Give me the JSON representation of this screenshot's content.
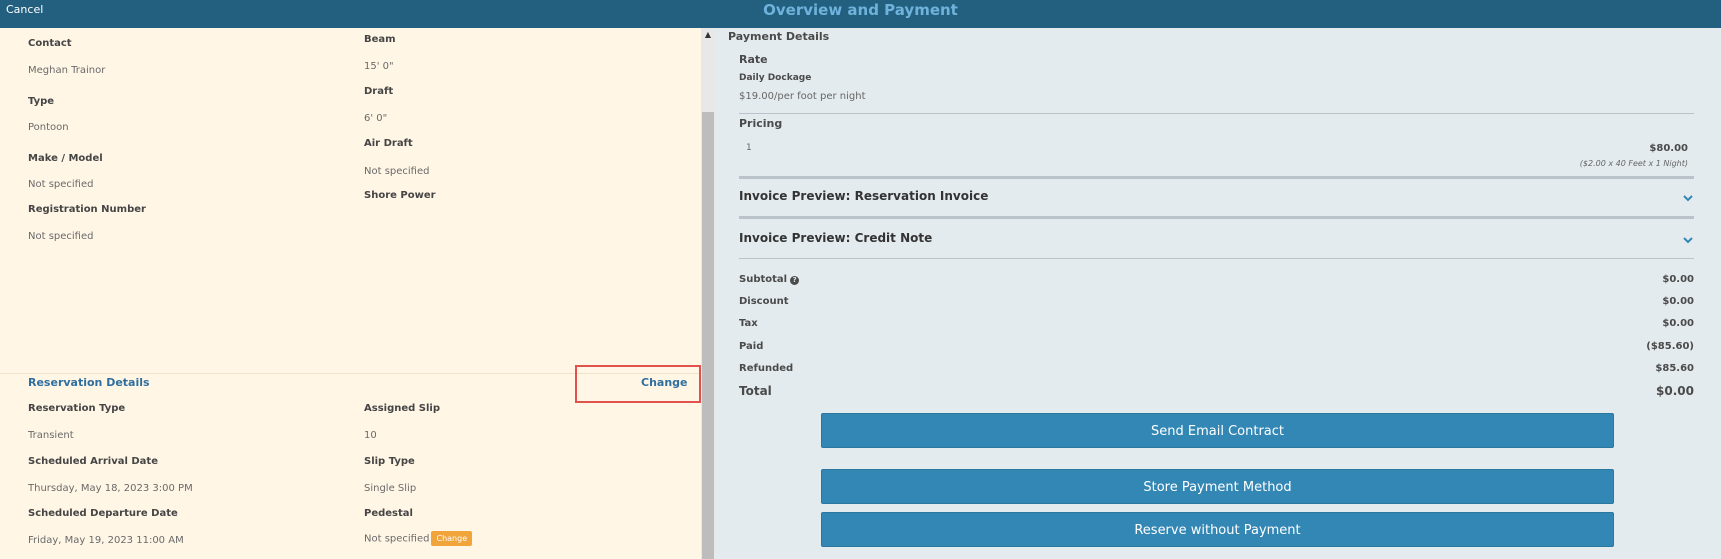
{
  "header": {
    "cancel": "Cancel",
    "title": "Overview and Payment"
  },
  "vessel": {
    "contact_label": "Contact",
    "contact_value": "Meghan Trainor",
    "type_label": "Type",
    "type_value": "Pontoon",
    "make_label": "Make / Model",
    "make_value": "Not specified",
    "reg_label": "Registration Number",
    "reg_value": "Not specified",
    "beam_label": "Beam",
    "beam_value": "15' 0\"",
    "draft_label": "Draft",
    "draft_value": "6' 0\"",
    "air_draft_label": "Air Draft",
    "air_draft_value": "Not specified",
    "shore_power_label": "Shore Power"
  },
  "reservation": {
    "title": "Reservation Details",
    "change": "Change",
    "res_type_label": "Reservation Type",
    "res_type_value": "Transient",
    "arrival_label": "Scheduled Arrival Date",
    "arrival_value": "Thursday, May 18, 2023 3:00 PM",
    "departure_label": "Scheduled Departure Date",
    "departure_value": "Friday, May 19, 2023 11:00 AM",
    "slip_label": "Assigned Slip",
    "slip_value": "10",
    "slip_type_label": "Slip Type",
    "slip_type_value": "Single Slip",
    "pedestal_label": "Pedestal",
    "pedestal_value": "Not specified",
    "pedestal_change": "Change"
  },
  "payment": {
    "heading": "Payment Details",
    "rate_label": "Rate",
    "rate_name": "Daily Dockage",
    "rate_value": "$19.00/per foot per night",
    "pricing_label": "Pricing",
    "pricing_row": {
      "qty": "1",
      "amount": "$80.00",
      "detail": "($2.00 x 40 Feet x 1 Night)"
    },
    "invoice_preview": "Invoice Preview: Reservation Invoice",
    "credit_preview": "Invoice Preview: Credit Note",
    "summary": {
      "subtotal_label": "Subtotal",
      "subtotal": "$0.00",
      "discount_label": "Discount",
      "discount": "$0.00",
      "tax_label": "Tax",
      "tax": "$0.00",
      "paid_label": "Paid",
      "paid": "($85.60)",
      "refunded_label": "Refunded",
      "refunded": "$85.60",
      "total_label": "Total",
      "total": "$0.00"
    },
    "buttons": {
      "send_email": "Send Email Contract",
      "store_payment": "Store Payment Method",
      "reserve_no_pay": "Reserve without Payment"
    }
  },
  "colors": {
    "header": "#23607f",
    "accent": "#3387b5",
    "highlight": "#e0524b",
    "left_bg": "#fff6e6",
    "right_bg": "#e4ebef"
  }
}
